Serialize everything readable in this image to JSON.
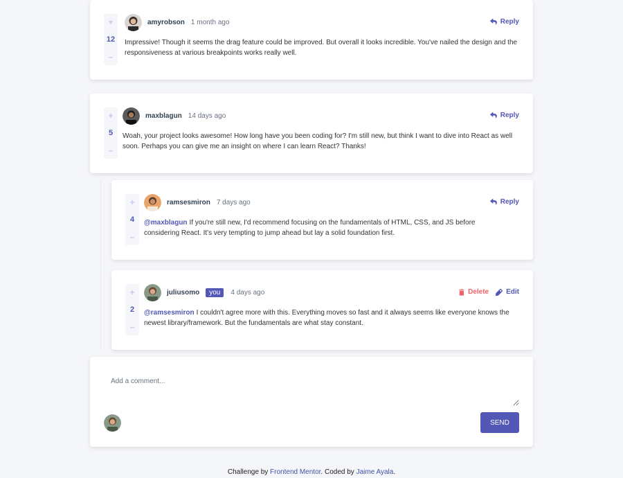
{
  "colors": {
    "background": "#f5f6fa",
    "moderate_blue": "#5357b6",
    "light_grayish_blue": "#c5c6ef",
    "soft_red": "#ed6368",
    "dark_blue": "#334253",
    "grayish_blue": "#67727e"
  },
  "comments": [
    {
      "username": "amyrobson",
      "time": "1 month ago",
      "score": "12",
      "action_label": "Reply",
      "action_icon": "reply-icon",
      "content": "Impressive! Though it seems the drag feature could be improved. But overall it looks incredible. You've nailed the design and the responsiveness at various breakpoints works really well."
    },
    {
      "username": "maxblagun",
      "time": "14 days ago",
      "score": "5",
      "action_label": "Reply",
      "action_icon": "reply-icon",
      "content": "Woah, your project looks awesome! How long have you been coding for? I'm still new, but think I want to dive into React as well soon. Perhaps you can give me an insight on where I can learn React? Thanks!"
    }
  ],
  "replies": [
    {
      "username": "ramsesmiron",
      "time": "7 days ago",
      "score": "4",
      "action_label": "Reply",
      "action_icon": "reply-icon",
      "mention": "@maxblagun",
      "content": "If you're still new, I'd recommend focusing on the fundamentals of HTML, CSS, and JS before considering React. It's very tempting to jump ahead but lay a solid foundation first."
    },
    {
      "username": "juliusomo",
      "badge": "you",
      "time": "4 days ago",
      "score": "2",
      "delete_label": "Delete",
      "delete_icon": "trash-icon",
      "edit_label": "Edit",
      "edit_icon": "pencil-icon",
      "mention": "@ramsesmiron",
      "content": "I couldn't agree more with this. Everything moves so fast and it always seems like everyone knows the newest library/framework. But the fundamentals are what stay constant."
    }
  ],
  "vote": {
    "plus": "+",
    "minus": "–"
  },
  "composer": {
    "placeholder": "Add a comment...",
    "send_label": "SEND"
  },
  "footer": {
    "prefix": "Challenge by",
    "link1": "Frontend Mentor",
    "middle": ". Coded by",
    "link2": "Jaime Ayala",
    "suffix": "."
  }
}
